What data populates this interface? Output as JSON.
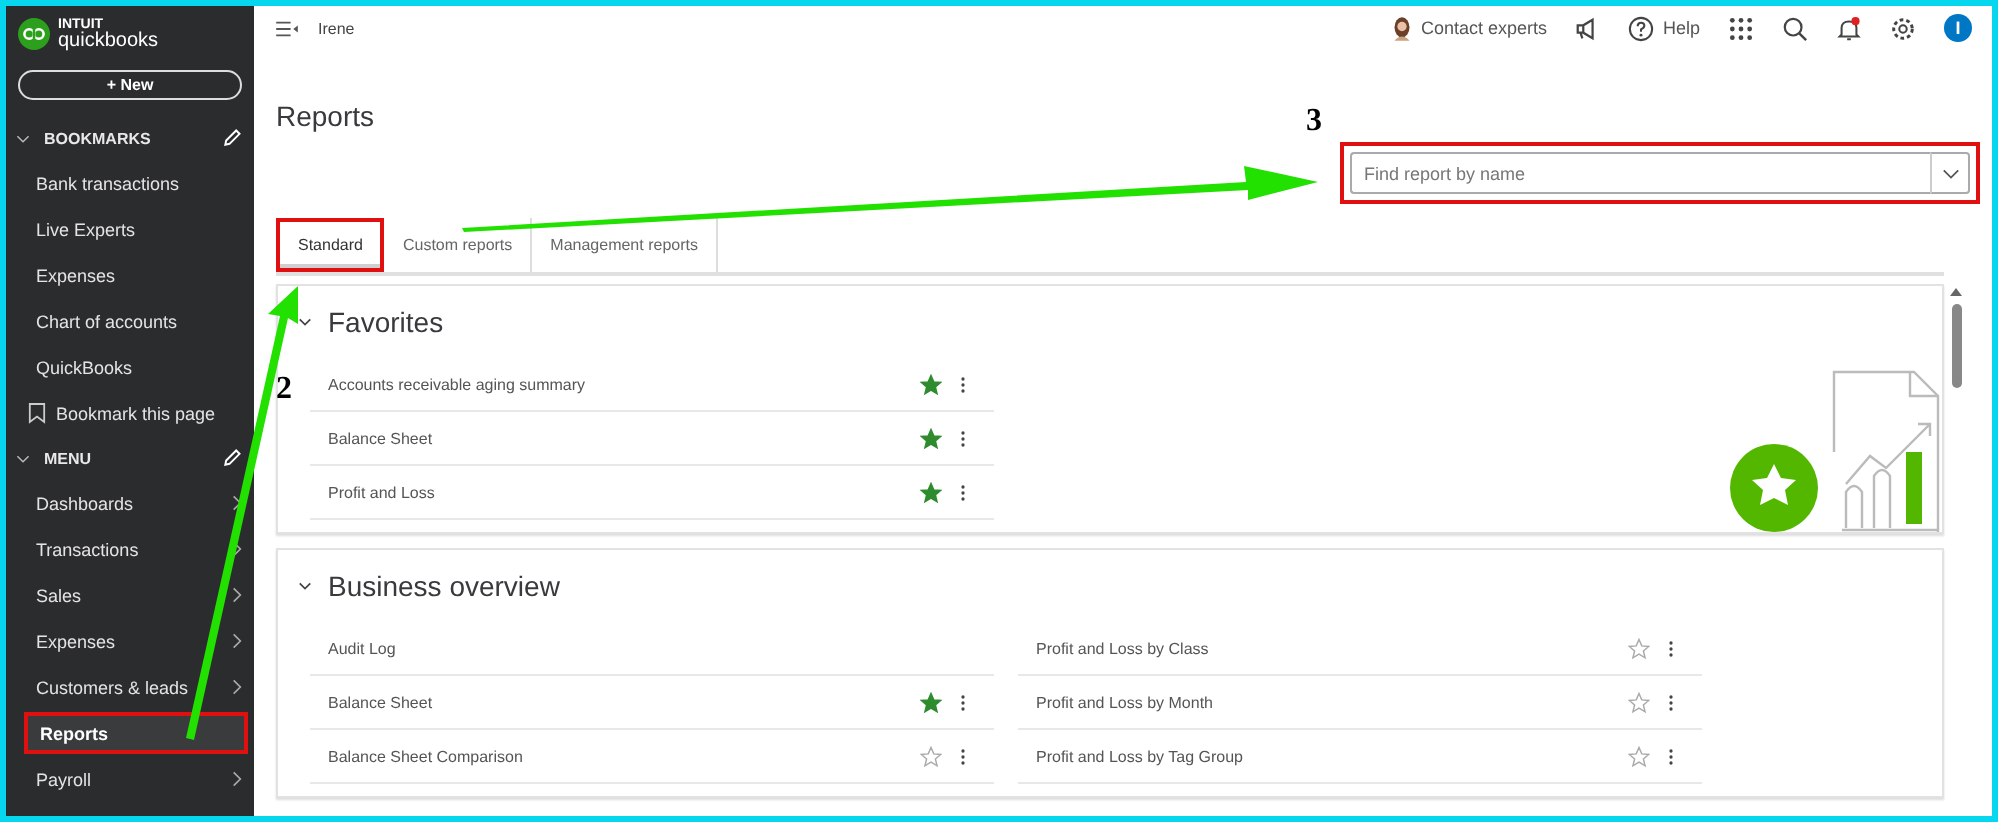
{
  "brand": {
    "top": "INTUIT",
    "name": "quickbooks"
  },
  "new_button": "+ New",
  "sidebar": [
    {
      "title": "BOOKMARKS",
      "expanded": true,
      "items": [
        {
          "label": "Bank transactions",
          "kind": "link",
          "selected": false,
          "highlighted": false
        },
        {
          "label": "Live Experts",
          "kind": "link",
          "selected": false,
          "highlighted": false
        },
        {
          "label": "Expenses",
          "kind": "link",
          "selected": false,
          "highlighted": false
        },
        {
          "label": "Chart of accounts",
          "kind": "link",
          "selected": false,
          "highlighted": false
        },
        {
          "label": "QuickBooks",
          "kind": "link",
          "selected": false,
          "highlighted": false
        },
        {
          "label": "Bookmark this page",
          "kind": "bookmark",
          "selected": false,
          "highlighted": false
        }
      ]
    },
    {
      "title": "MENU",
      "expanded": true,
      "items": [
        {
          "label": "Dashboards",
          "kind": "submenu",
          "selected": false,
          "highlighted": false
        },
        {
          "label": "Transactions",
          "kind": "submenu",
          "selected": false,
          "highlighted": false
        },
        {
          "label": "Sales",
          "kind": "submenu",
          "selected": false,
          "highlighted": false
        },
        {
          "label": "Expenses",
          "kind": "submenu",
          "selected": false,
          "highlighted": false
        },
        {
          "label": "Customers & leads",
          "kind": "submenu",
          "selected": false,
          "highlighted": false
        },
        {
          "label": "Reports",
          "kind": "link",
          "selected": true,
          "highlighted": true
        },
        {
          "label": "Payroll",
          "kind": "submenu",
          "selected": false,
          "highlighted": false
        }
      ]
    }
  ],
  "topbar": {
    "company": "Irene",
    "contact": "Contact experts",
    "help": "Help",
    "avatar_initial": "I",
    "notification": true
  },
  "page": {
    "title": "Reports",
    "search": {
      "placeholder": "Find report by name",
      "highlighted": true
    },
    "tabs": [
      {
        "label": "Standard",
        "selected": true,
        "highlighted": true
      },
      {
        "label": "Custom reports",
        "selected": false,
        "highlighted": false
      },
      {
        "label": "Management reports",
        "selected": false,
        "highlighted": false
      }
    ],
    "sections": [
      {
        "title": "Favorites",
        "expanded": true,
        "illustration": true,
        "columns": [
          [
            {
              "name": "Accounts receivable aging summary",
              "starred": true
            },
            {
              "name": "Balance Sheet",
              "starred": true
            },
            {
              "name": "Profit and Loss",
              "starred": true
            }
          ]
        ]
      },
      {
        "title": "Business overview",
        "expanded": true,
        "columns": [
          [
            {
              "name": "Audit Log"
            },
            {
              "name": "Balance Sheet",
              "starred": true
            },
            {
              "name": "Balance Sheet Comparison",
              "starred": false
            }
          ],
          [
            {
              "name": "Profit and Loss by Class",
              "starred": false
            },
            {
              "name": "Profit and Loss by Month",
              "starred": false
            },
            {
              "name": "Profit and Loss by Tag Group",
              "starred": false
            }
          ]
        ]
      }
    ]
  },
  "annotations": {
    "labels": [
      "2",
      "3"
    ]
  }
}
